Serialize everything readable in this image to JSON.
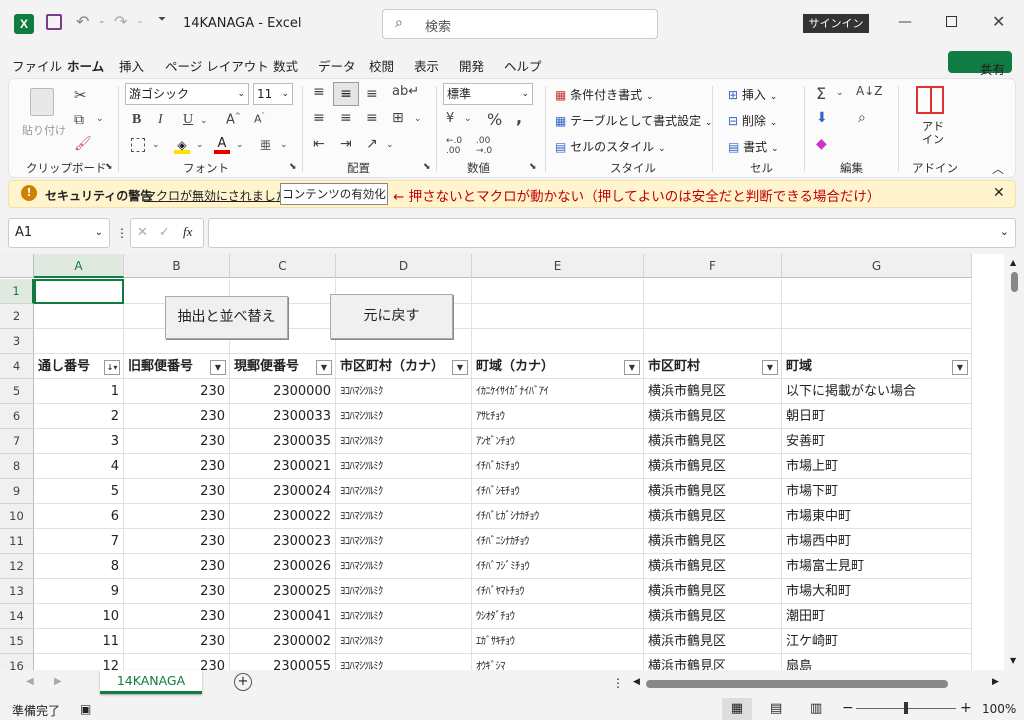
{
  "title": {
    "doc": "14KANAGA",
    "sep": "-",
    "app": "Excel",
    "search_placeholder": "検索",
    "signin": "サインイン"
  },
  "menu": [
    "ファイル",
    "ホーム",
    "挿入",
    "ページ レイアウト",
    "数式",
    "データ",
    "校閲",
    "表示",
    "開発",
    "ヘルプ"
  ],
  "share": "共有",
  "ribbon": {
    "paste": "貼り付け",
    "font_name": "游ゴシック",
    "font_size": "11",
    "number_format": "標準",
    "cond_format": "条件付き書式",
    "table_format": "テーブルとして書式設定",
    "cell_style": "セルのスタイル",
    "insert": "挿入",
    "delete": "削除",
    "format": "書式",
    "addin": "アド\nイン",
    "groups": [
      "クリップボード",
      "フォント",
      "配置",
      "数値",
      "スタイル",
      "セル",
      "編集",
      "アドイン"
    ]
  },
  "warning": {
    "title": "セキュリティの警告",
    "message": "マクロが無効にされました。",
    "button": "コンテンツの有効化",
    "note": "← 押さないとマクロが動かない（押してよいのは安全だと判断できる場合だけ）"
  },
  "formula": {
    "namebox": "A1",
    "fx": "fx",
    "value": ""
  },
  "columns": [
    "A",
    "B",
    "C",
    "D",
    "E",
    "F",
    "G"
  ],
  "buttons": {
    "extract": "抽出と並べ替え",
    "restore": "元に戻す"
  },
  "table": {
    "headers": [
      "通し番号",
      "旧郵便番号",
      "現郵便番号",
      "市区町村（カナ）",
      "町域（カナ）",
      "市区町村",
      "町域"
    ],
    "rows": [
      [
        "1",
        "230",
        "2300000",
        "ﾖｺﾊﾏｼﾂﾙﾐｸ",
        "ｲｶﾆｹｲｻｲｶﾞﾅｲﾊﾞｱｲ",
        "横浜市鶴見区",
        "以下に掲載がない場合"
      ],
      [
        "2",
        "230",
        "2300033",
        "ﾖｺﾊﾏｼﾂﾙﾐｸ",
        "ｱｻﾋﾁｮｳ",
        "横浜市鶴見区",
        "朝日町"
      ],
      [
        "3",
        "230",
        "2300035",
        "ﾖｺﾊﾏｼﾂﾙﾐｸ",
        "ｱﾝｾﾞﾝﾁｮｳ",
        "横浜市鶴見区",
        "安善町"
      ],
      [
        "4",
        "230",
        "2300021",
        "ﾖｺﾊﾏｼﾂﾙﾐｸ",
        "ｲﾁﾊﾞｶﾐﾁｮｳ",
        "横浜市鶴見区",
        "市場上町"
      ],
      [
        "5",
        "230",
        "2300024",
        "ﾖｺﾊﾏｼﾂﾙﾐｸ",
        "ｲﾁﾊﾞｼﾓﾁｮｳ",
        "横浜市鶴見区",
        "市場下町"
      ],
      [
        "6",
        "230",
        "2300022",
        "ﾖｺﾊﾏｼﾂﾙﾐｸ",
        "ｲﾁﾊﾞﾋｶﾞｼﾅｶﾁｮｳ",
        "横浜市鶴見区",
        "市場東中町"
      ],
      [
        "7",
        "230",
        "2300023",
        "ﾖｺﾊﾏｼﾂﾙﾐｸ",
        "ｲﾁﾊﾞﾆｼﾅｶﾁｮｳ",
        "横浜市鶴見区",
        "市場西中町"
      ],
      [
        "8",
        "230",
        "2300026",
        "ﾖｺﾊﾏｼﾂﾙﾐｸ",
        "ｲﾁﾊﾞﾌｼﾞﾐﾁｮｳ",
        "横浜市鶴見区",
        "市場富士見町"
      ],
      [
        "9",
        "230",
        "2300025",
        "ﾖｺﾊﾏｼﾂﾙﾐｸ",
        "ｲﾁﾊﾞﾔﾏﾄﾁｮｳ",
        "横浜市鶴見区",
        "市場大和町"
      ],
      [
        "10",
        "230",
        "2300041",
        "ﾖｺﾊﾏｼﾂﾙﾐｸ",
        "ｳｼｵﾀﾞﾁｮｳ",
        "横浜市鶴見区",
        "潮田町"
      ],
      [
        "11",
        "230",
        "2300002",
        "ﾖｺﾊﾏｼﾂﾙﾐｸ",
        "ｴｶﾞｻｷﾁｮｳ",
        "横浜市鶴見区",
        "江ケ崎町"
      ],
      [
        "12",
        "230",
        "2300055",
        "ﾖｺﾊﾏｼﾂﾙﾐｸ",
        "ｵｳｷﾞｼﾏ",
        "横浜市鶴見区",
        "扇島"
      ]
    ]
  },
  "row_numbers": [
    "1",
    "2",
    "3",
    "4",
    "5",
    "6",
    "7",
    "8",
    "9",
    "10",
    "11",
    "12",
    "13",
    "14",
    "15",
    "16"
  ],
  "sheet_tab": "14KANAGA",
  "status": {
    "ready": "準備完了",
    "zoom": "100%"
  },
  "colors": {
    "excel_green": "#107c41",
    "warning_red": "#c00000",
    "share_green": "#107c41"
  }
}
